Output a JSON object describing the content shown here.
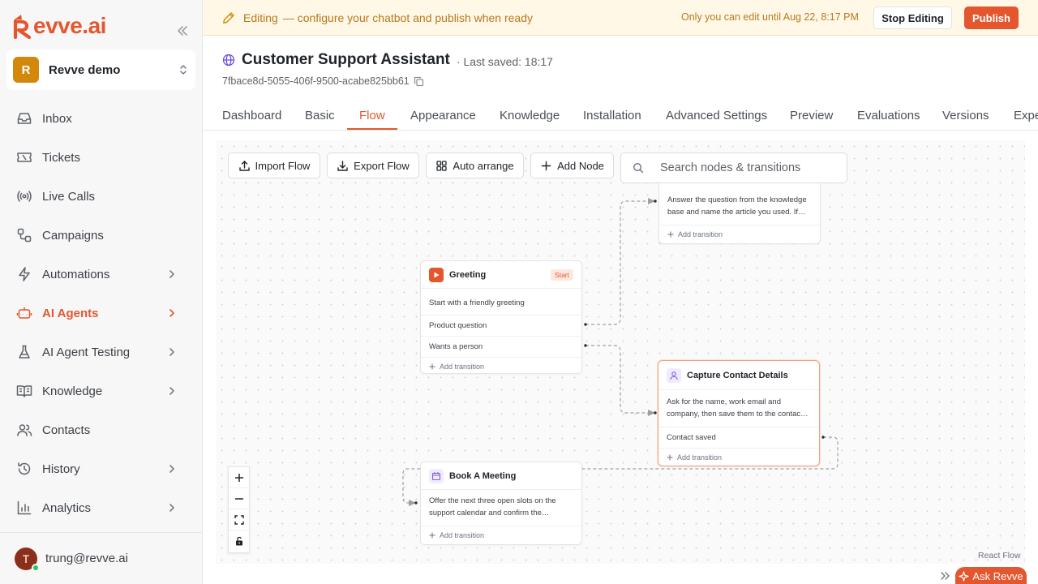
{
  "brand": {
    "logo_letter": "R",
    "logo_text": "evve.ai",
    "accent": "#e4572e"
  },
  "workspace": {
    "initial": "R",
    "name": "Revve demo"
  },
  "nav": [
    {
      "label": "Inbox",
      "icon": "inbox-icon"
    },
    {
      "label": "Tickets",
      "icon": "ticket-icon"
    },
    {
      "label": "Live Calls",
      "icon": "broadcast-icon"
    },
    {
      "label": "Campaigns",
      "icon": "route-icon"
    },
    {
      "label": "Automations",
      "icon": "lightning-icon"
    },
    {
      "label": "AI Agents",
      "icon": "bot-icon"
    },
    {
      "label": "AI Agent Testing",
      "icon": "flask-icon"
    },
    {
      "label": "Knowledge",
      "icon": "book-icon"
    },
    {
      "label": "Contacts",
      "icon": "users-icon"
    },
    {
      "label": "History",
      "icon": "history-icon"
    },
    {
      "label": "Analytics",
      "icon": "bar-chart-icon"
    }
  ],
  "user": {
    "initial": "T",
    "email": "trung@revve.ai"
  },
  "banner": {
    "editing": "Editing",
    "description": "— configure your chatbot and publish when ready",
    "lock_note": "Only you can edit until Aug 22, 8:17 PM",
    "stop_label": "Stop Editing",
    "publish_label": "Publish"
  },
  "header": {
    "title": "Customer Support Assistant",
    "saved": "· Last saved: 18:17",
    "uuid": "7fbace8d-5055-406f-9500-acabe825bb61"
  },
  "tabs": [
    "Dashboard",
    "Basic",
    "Flow",
    "Appearance",
    "Knowledge",
    "Installation",
    "Advanced Settings",
    "Preview",
    "Evaluations",
    "Versions",
    "Expe"
  ],
  "active_tab": "Flow",
  "toolbar": {
    "import_label": "Import Flow",
    "export_label": "Export Flow",
    "arrange_label": "Auto arrange",
    "add_node_label": "Add Node",
    "search_placeholder": "Search nodes & transitions"
  },
  "nodes": {
    "knowledge": {
      "desc": "Answer the question from the knowledge base and name the article you used. If…",
      "add": "Add transition"
    },
    "greeting": {
      "title": "Greeting",
      "badge": "Start",
      "desc": "Start with a friendly greeting",
      "transitions": [
        "Product question",
        "Wants a person"
      ],
      "add": "Add transition"
    },
    "capture": {
      "title": "Capture Contact Details",
      "desc": "Ask for the name, work email and company, then save them to the contac…",
      "transitions": [
        "Contact saved"
      ],
      "add": "Add transition"
    },
    "meeting": {
      "title": "Book A Meeting",
      "desc": "Offer the next three open slots on the support calendar and confirm the…",
      "add": "Add transition"
    }
  },
  "attribution": "React Flow",
  "ask_label": "Ask Revve"
}
